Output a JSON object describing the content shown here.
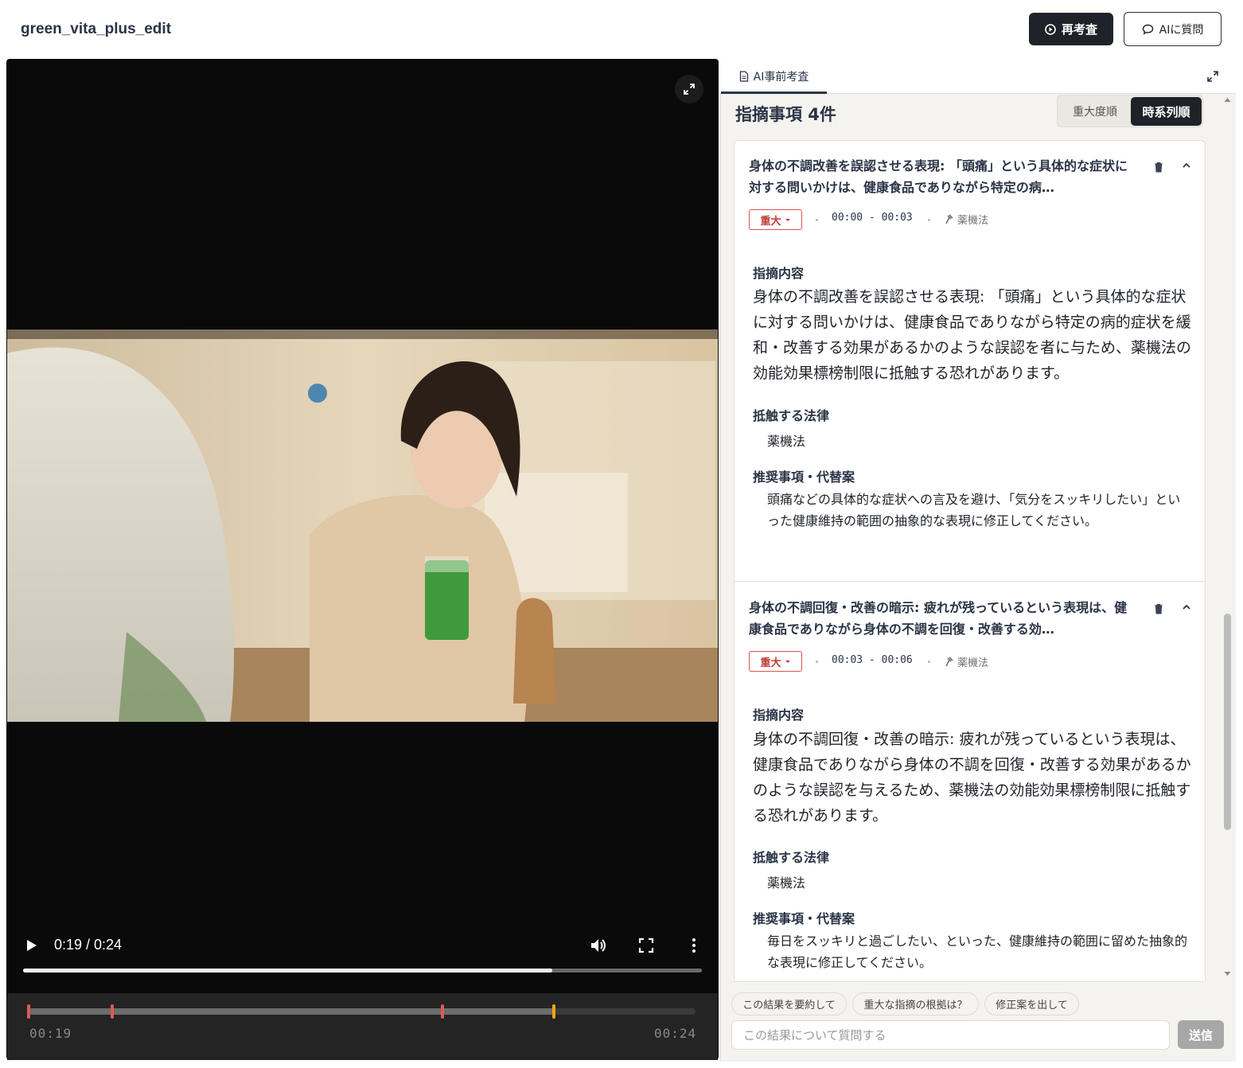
{
  "app": {
    "title": "green_vita_plus_edit",
    "rerun_label": "再考査",
    "ask_ai_label": "AIに質問"
  },
  "video": {
    "current_time": "0:19",
    "duration": "0:24",
    "time_display": "0:19 / 0:24",
    "played_fraction": 0.78,
    "icons": [
      "play-icon",
      "volume-icon",
      "fullscreen-icon",
      "more-icon",
      "expand-icon"
    ]
  },
  "timeline": {
    "start_label": "00:19",
    "end_label": "00:24",
    "progress_fraction": 0.79,
    "markers": [
      {
        "position_fraction": 0.0,
        "color": "#e05a4e"
      },
      {
        "position_fraction": 0.125,
        "color": "#e05a4e"
      },
      {
        "position_fraction": 0.62,
        "color": "#e05a4e"
      },
      {
        "position_fraction": 0.787,
        "color": "#f2a516"
      }
    ]
  },
  "panel": {
    "tab_label": "AI事前考査",
    "heading": "指摘事項 4件",
    "sort_severity": "重大度順",
    "sort_time": "時系列順",
    "section_labels": {
      "content": "指摘内容",
      "law": "抵触する法律",
      "recommendation": "推奨事項・代替案"
    },
    "findings": [
      {
        "title": "身体の不調改善を誤認させる表現: 「頭痛」という具体的な症状に対する問いかけは、健康食品でありながら特定の病…",
        "severity": "重大",
        "time_range": "00:00 - 00:03",
        "law_tag": "薬機法",
        "content": "身体の不調改善を誤認させる表現: 「頭痛」という具体的な症状に対する問いかけは、健康食品でありながら特定の病的症状を緩和・改善する効果があるかのような誤認を者に与ため、薬機法の効能効果標榜制限に抵触する恐れがあります。",
        "law": "薬機法",
        "recommendation": "頭痛などの具体的な症状への言及を避け、「気分をスッキリしたい」といった健康維持の範囲の抽象的な表現に修正してください。"
      },
      {
        "title": "身体の不調回復・改善の暗示: 疲れが残っているという表現は、健康食品でありながら身体の不調を回復・改善する効…",
        "severity": "重大",
        "time_range": "00:03 - 00:06",
        "law_tag": "薬機法",
        "content": "身体の不調回復・改善の暗示: 疲れが残っているという表現は、健康食品でありながら身体の不調を回復・改善する効果があるかのような誤認を与えるため、薬機法の効能効果標榜制限に抵触する恐れがあります。",
        "law": "薬機法",
        "recommendation": "毎日をスッキリと過ごしたい、といった、健康維持の範囲に留めた抽象的な表現に修正してください。"
      }
    ],
    "suggestions": [
      "この結果を要約して",
      "重大な指摘の根拠は？",
      "修正案を出して"
    ],
    "input_placeholder": "この結果について質問する",
    "send_label": "送信"
  }
}
